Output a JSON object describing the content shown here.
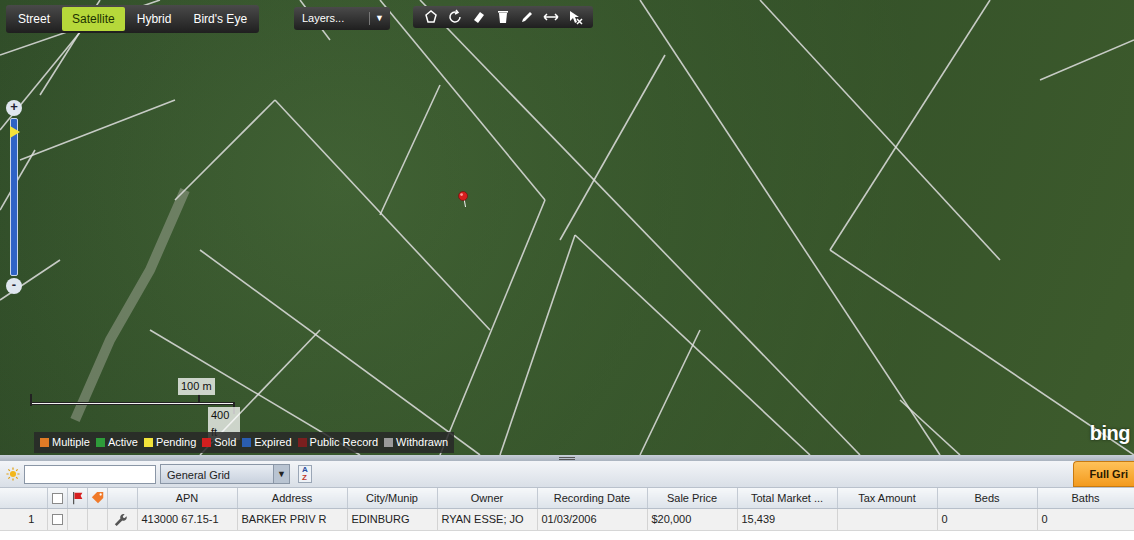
{
  "map_types": [
    {
      "label": "Street",
      "selected": false
    },
    {
      "label": "Satellite",
      "selected": true
    },
    {
      "label": "Hybrid",
      "selected": false
    },
    {
      "label": "Bird's Eye",
      "selected": false
    }
  ],
  "layers": {
    "label": "Layers...",
    "caret": "▼"
  },
  "zoom": {
    "plus": "+",
    "minus": "-",
    "level": 0.92
  },
  "scale": {
    "metric": "100 m",
    "imperial": "400 ft"
  },
  "legend": [
    {
      "label": "Multiple",
      "color": "#e07b26"
    },
    {
      "label": "Active",
      "color": "#2e9b3a"
    },
    {
      "label": "Pending",
      "color": "#f2e33a"
    },
    {
      "label": "Sold",
      "color": "#d21f1f"
    },
    {
      "label": "Expired",
      "color": "#2a5db0"
    },
    {
      "label": "Public Record",
      "color": "#7a1f1f"
    },
    {
      "label": "Withdrawn",
      "color": "#9a9a9a"
    }
  ],
  "logo": "bing",
  "grid_toolbar": {
    "search": {
      "value": ""
    },
    "view": "General Grid",
    "caret": "▼",
    "sort": {
      "top": "A",
      "bottom": "Z"
    },
    "full_grid": "Full Gri"
  },
  "table": {
    "header_checked": false,
    "columns": [
      "APN",
      "Address",
      "City/Munip",
      "Owner",
      "Recording Date",
      "Sale Price",
      "Total Market ...",
      "Tax Amount",
      "Beds",
      "Baths"
    ],
    "rows": [
      {
        "number": "1",
        "checked": false,
        "cells": [
          "413000 67.15-1",
          "BARKER PRIV R",
          "EDINBURG",
          "RYAN ESSE; JO",
          "01/03/2006",
          "$20,000",
          "15,439",
          "",
          "0",
          "0"
        ]
      }
    ]
  }
}
